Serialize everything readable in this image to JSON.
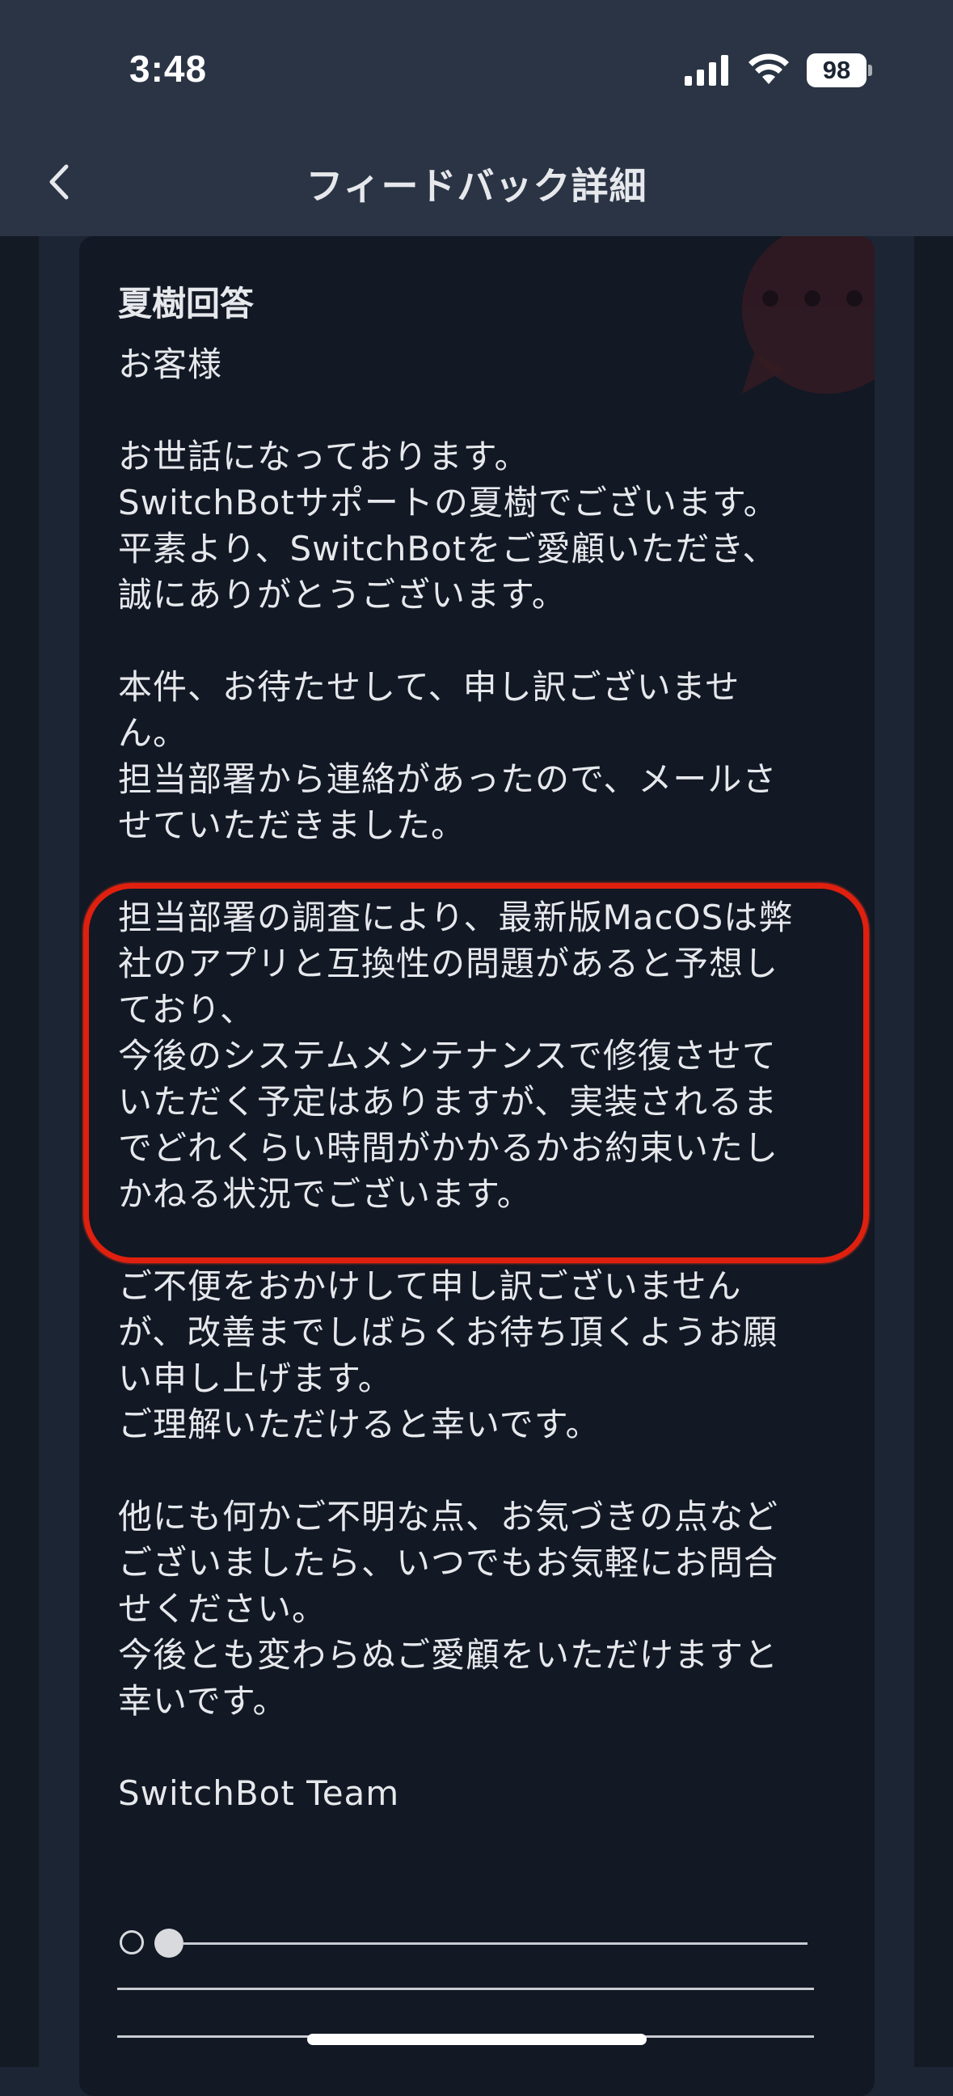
{
  "status_bar": {
    "time": "3:48",
    "battery": "98",
    "icons": [
      "signal-icon",
      "wifi-icon",
      "battery-icon"
    ]
  },
  "nav": {
    "back_icon": "chevron-left-icon",
    "title": "フィードバック詳細"
  },
  "card": {
    "title": "夏樹回答",
    "paragraphs": [
      "お客様",
      "お世話になっております。\nSwitchBotサポートの夏樹でございます。\n平素より、SwitchBotをご愛顧いただき、\n誠にありがとうございます。",
      "本件、お待たせして、申し訳ございませ\nん。\n担当部署から連絡があったので、メールさ\nせていただきました。",
      "担当部署の調査により、最新版MacOSは弊\n社のアプリと互換性の問題があると予想し\nており、\n今後のシステムメンテナンスで修復させて\nいただく予定はありますが、実装されるま\nでどれくらい時間がかかるかお約束いたし\nかねる状況でございます。",
      "ご不便をおかけして申し訳ございません\nが、改善までしばらくお待ち頂くようお願\nい申し上げます。\nご理解いただけると幸いです。",
      "他にも何かご不明な点、お気づきの点など\nございましたら、いつでもお気軽にお問合\nせください。\n今後とも変わらぬご愛顧をいただけますと\n幸いです。",
      "SwitchBot Team"
    ]
  },
  "colors": {
    "header_bg": "#2a3444",
    "card_bg": "#121824",
    "highlight": "#e0200e",
    "text": "#e6e8ec"
  }
}
